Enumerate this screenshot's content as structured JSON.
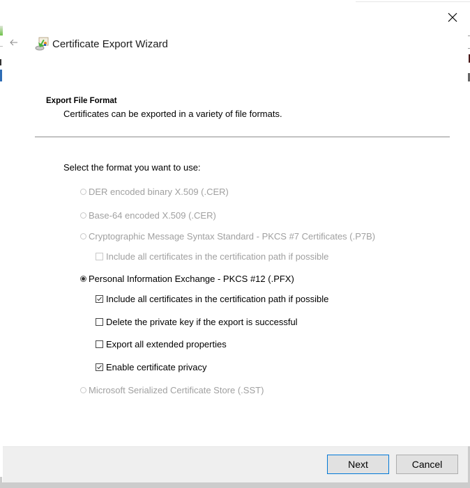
{
  "window": {
    "title": "Certificate Export Wizard",
    "back_icon": "back-arrow-icon",
    "close_icon": "close-icon",
    "wizard_icon": "certificate-export-icon"
  },
  "header": {
    "section_title": "Export File Format",
    "section_description": "Certificates can be exported in a variety of file formats."
  },
  "body": {
    "prompt": "Select the format you want to use:",
    "formats": [
      {
        "label": "DER encoded binary X.509 (.CER)",
        "type": "radio",
        "selected": false,
        "enabled": false
      },
      {
        "label": "Base-64 encoded X.509 (.CER)",
        "type": "radio",
        "selected": false,
        "enabled": false
      },
      {
        "label": "Cryptographic Message Syntax Standard - PKCS #7 Certificates (.P7B)",
        "type": "radio",
        "selected": false,
        "enabled": false
      },
      {
        "label": "Include all certificates in the certification path if possible",
        "type": "checkbox",
        "checked": false,
        "enabled": false
      },
      {
        "label": "Personal Information Exchange - PKCS #12 (.PFX)",
        "type": "radio",
        "selected": true,
        "enabled": true
      },
      {
        "label": "Include all certificates in the certification path if possible",
        "type": "checkbox",
        "checked": true,
        "enabled": true
      },
      {
        "label": "Delete the private key if the export is successful",
        "type": "checkbox",
        "checked": false,
        "enabled": true
      },
      {
        "label": "Export all extended properties",
        "type": "checkbox",
        "checked": false,
        "enabled": true
      },
      {
        "label": "Enable certificate privacy",
        "type": "checkbox",
        "checked": true,
        "enabled": true
      },
      {
        "label": "Microsoft Serialized Certificate Store (.SST)",
        "type": "radio",
        "selected": false,
        "enabled": false
      }
    ]
  },
  "footer": {
    "next_label": "Next",
    "cancel_label": "Cancel"
  },
  "colors": {
    "default_button_border": "#0078d7",
    "disabled_text": "#a0a0a0",
    "footer_background": "#efefef"
  }
}
